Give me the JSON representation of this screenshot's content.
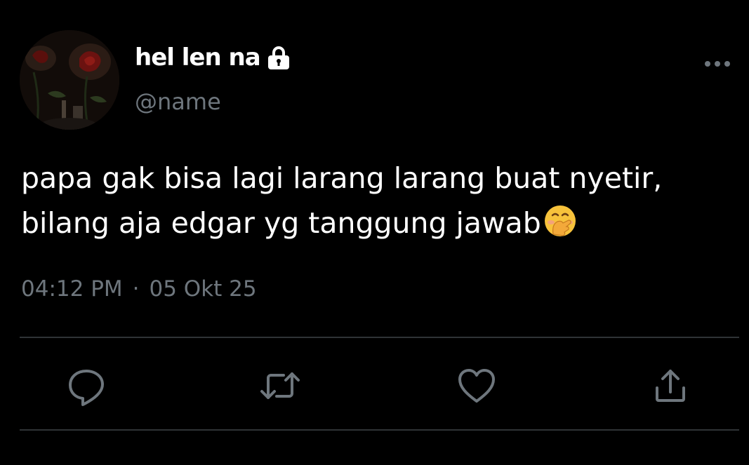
{
  "tweet": {
    "author": {
      "display_name": "hel len na",
      "handle": "@name",
      "protected_icon": "lock-icon",
      "avatar_icon": "avatar-roses-photo"
    },
    "menu_icon": "more-horizontal-icon",
    "text_lines": [
      "papa gak bisa lagi larang larang buat nyetir,",
      "bilang aja edgar yg tanggung jawab"
    ],
    "text_emoji": "🤭",
    "time": "04:12 PM",
    "separator": "·",
    "date": "05 Okt 25",
    "actions": {
      "reply_icon": "reply-icon",
      "retweet_icon": "retweet-icon",
      "like_icon": "heart-icon",
      "share_icon": "share-icon"
    }
  },
  "colors": {
    "background": "#000000",
    "primary_text": "#ffffff",
    "secondary_text": "#6e767d",
    "divider": "#2f3336",
    "icon": "#6e767d"
  }
}
